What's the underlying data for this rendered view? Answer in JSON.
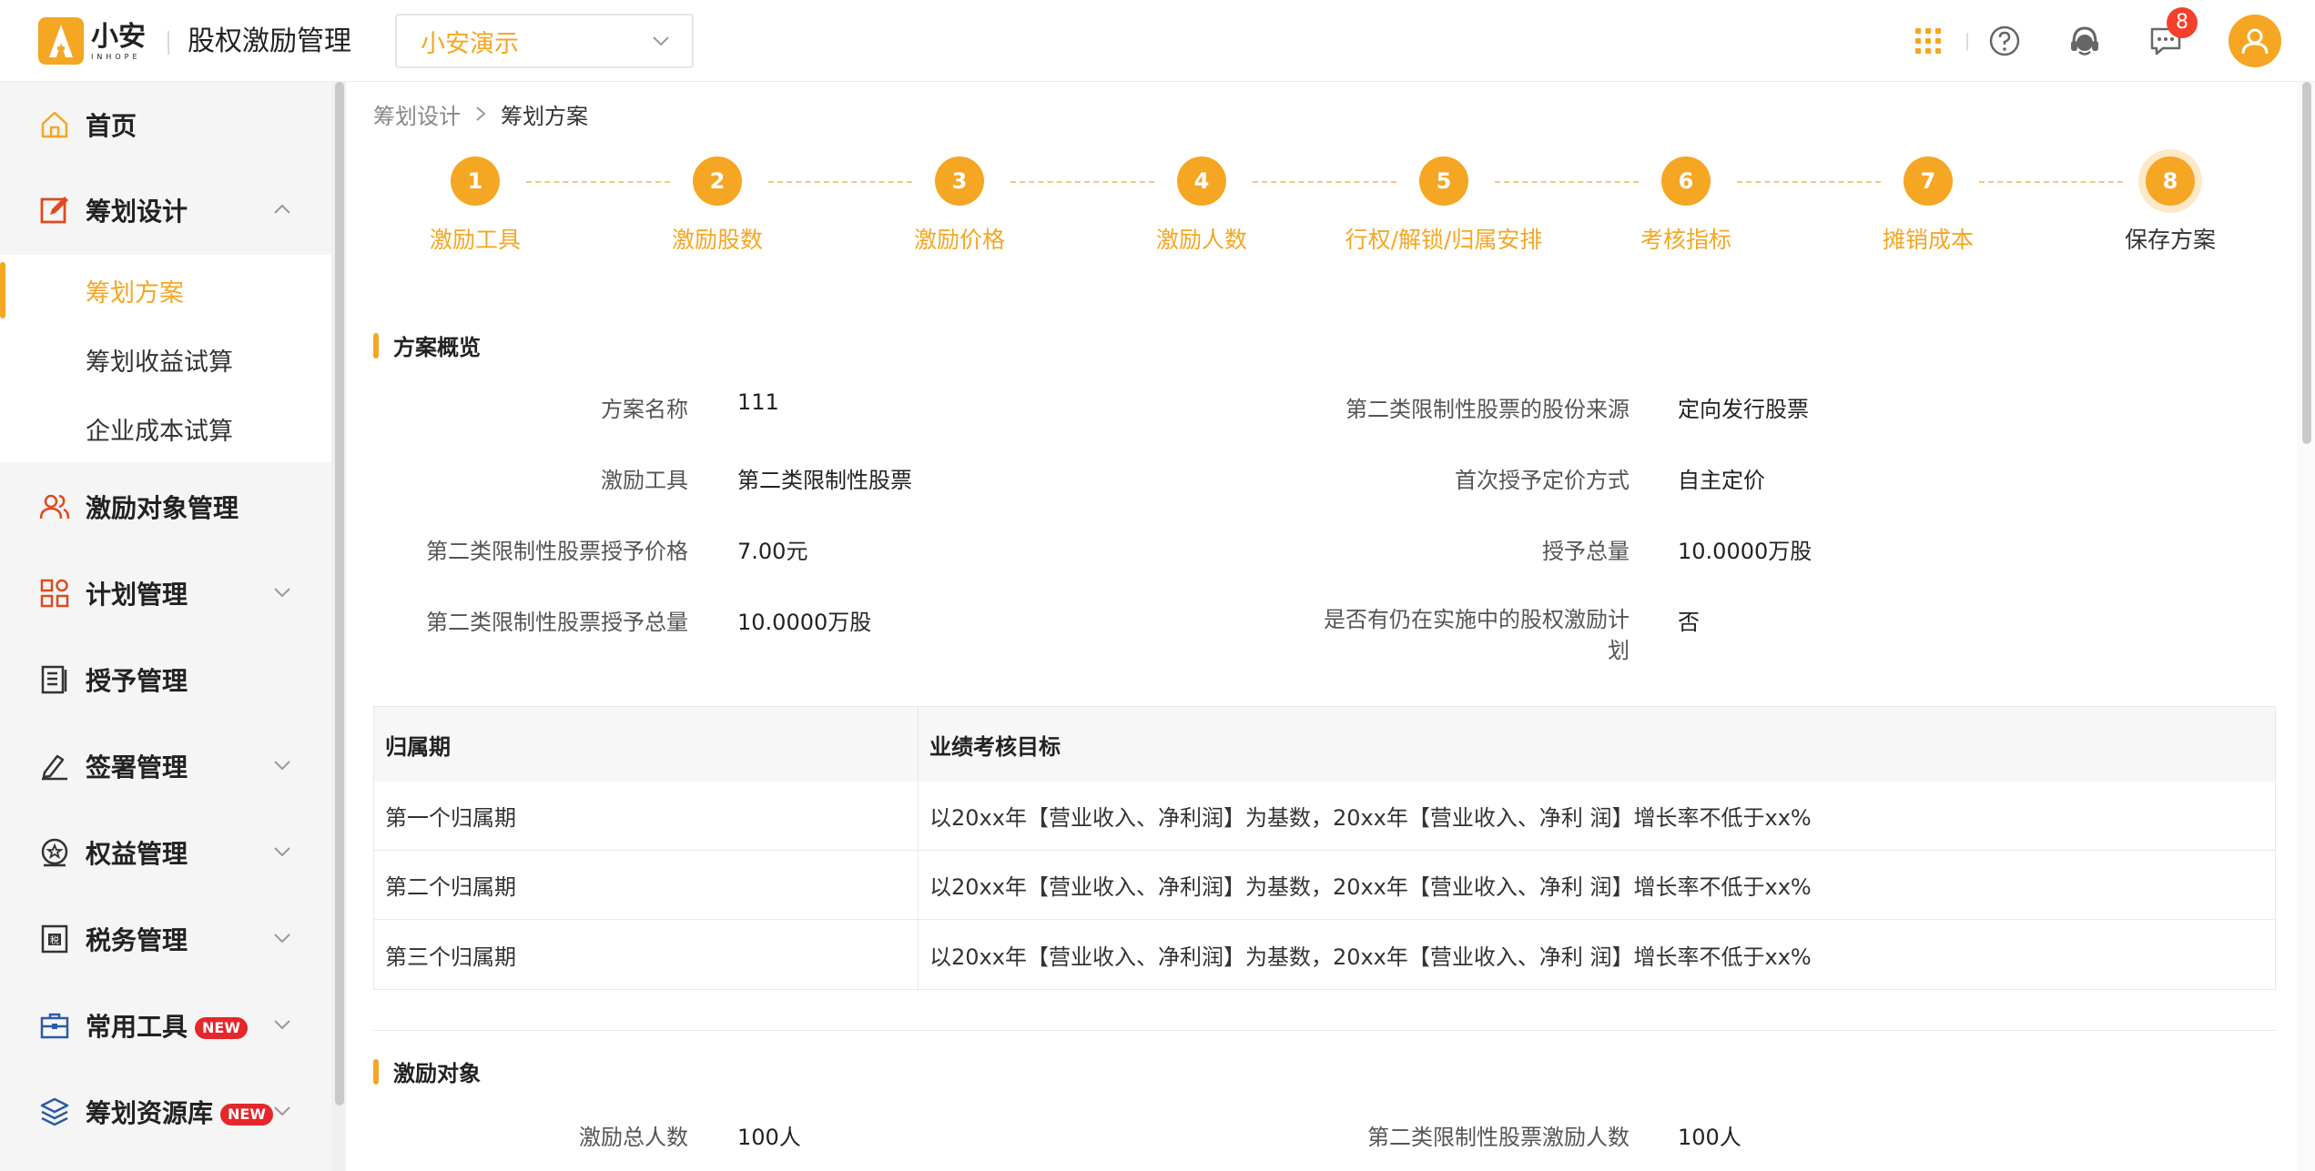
{
  "header": {
    "logo_cn": "小安",
    "logo_en": "INHOPE",
    "app_title": "股权激励管理",
    "company_select": "小安演示",
    "notification_count": "8"
  },
  "sidebar": {
    "items": [
      {
        "label": "首页",
        "icon": "home-icon"
      },
      {
        "label": "筹划设计",
        "icon": "edit-icon"
      },
      {
        "label": "激励对象管理",
        "icon": "users-icon"
      },
      {
        "label": "计划管理",
        "icon": "grid-icon"
      },
      {
        "label": "授予管理",
        "icon": "document-icon"
      },
      {
        "label": "签署管理",
        "icon": "sign-icon"
      },
      {
        "label": "权益管理",
        "icon": "equity-icon"
      },
      {
        "label": "税务管理",
        "icon": "tax-icon"
      },
      {
        "label": "常用工具",
        "icon": "toolbox-icon",
        "badge": "NEW"
      },
      {
        "label": "筹划资源库",
        "icon": "layers-icon",
        "badge": "NEW"
      }
    ],
    "sub_items": [
      {
        "label": "筹划方案"
      },
      {
        "label": "筹划收益试算"
      },
      {
        "label": "企业成本试算"
      }
    ]
  },
  "breadcrumb": {
    "parent": "筹划设计",
    "current": "筹划方案"
  },
  "steps": [
    {
      "num": "1",
      "label": "激励工具"
    },
    {
      "num": "2",
      "label": "激励股数"
    },
    {
      "num": "3",
      "label": "激励价格"
    },
    {
      "num": "4",
      "label": "激励人数"
    },
    {
      "num": "5",
      "label": "行权/解锁/归属安排"
    },
    {
      "num": "6",
      "label": "考核指标"
    },
    {
      "num": "7",
      "label": "摊销成本"
    },
    {
      "num": "8",
      "label": "保存方案"
    }
  ],
  "overview": {
    "title": "方案概览",
    "fields": [
      {
        "label": "方案名称",
        "value": "111"
      },
      {
        "label": "第二类限制性股票的股份来源",
        "value": "定向发行股票"
      },
      {
        "label": "激励工具",
        "value": "第二类限制性股票"
      },
      {
        "label": "首次授予定价方式",
        "value": "自主定价"
      },
      {
        "label": "第二类限制性股票授予价格",
        "value": "7.00元"
      },
      {
        "label": "授予总量",
        "value": "10.0000万股"
      },
      {
        "label": "第二类限制性股票授予总量",
        "value": "10.0000万股"
      },
      {
        "label": "是否有仍在实施中的股权激励计",
        "label2": "划",
        "value": "否"
      }
    ]
  },
  "table": {
    "headers": [
      "归属期",
      "业绩考核目标"
    ],
    "rows": [
      [
        "第一个归属期",
        "以20xx年【营业收入、净利润】为基数，20xx年【营业收入、净利 润】增长率不低于xx%"
      ],
      [
        "第二个归属期",
        "以20xx年【营业收入、净利润】为基数，20xx年【营业收入、净利 润】增长率不低于xx%"
      ],
      [
        "第三个归属期",
        "以20xx年【营业收入、净利润】为基数，20xx年【营业收入、净利 润】增长率不低于xx%"
      ]
    ]
  },
  "targets": {
    "title": "激励对象",
    "fields": [
      {
        "label": "激励总人数",
        "value": "100人"
      },
      {
        "label": "第二类限制性股票激励人数",
        "value": "100人"
      }
    ]
  },
  "colors": {
    "accent": "#f5a623",
    "badge": "#f5402b",
    "new_badge": "#e5262a"
  }
}
